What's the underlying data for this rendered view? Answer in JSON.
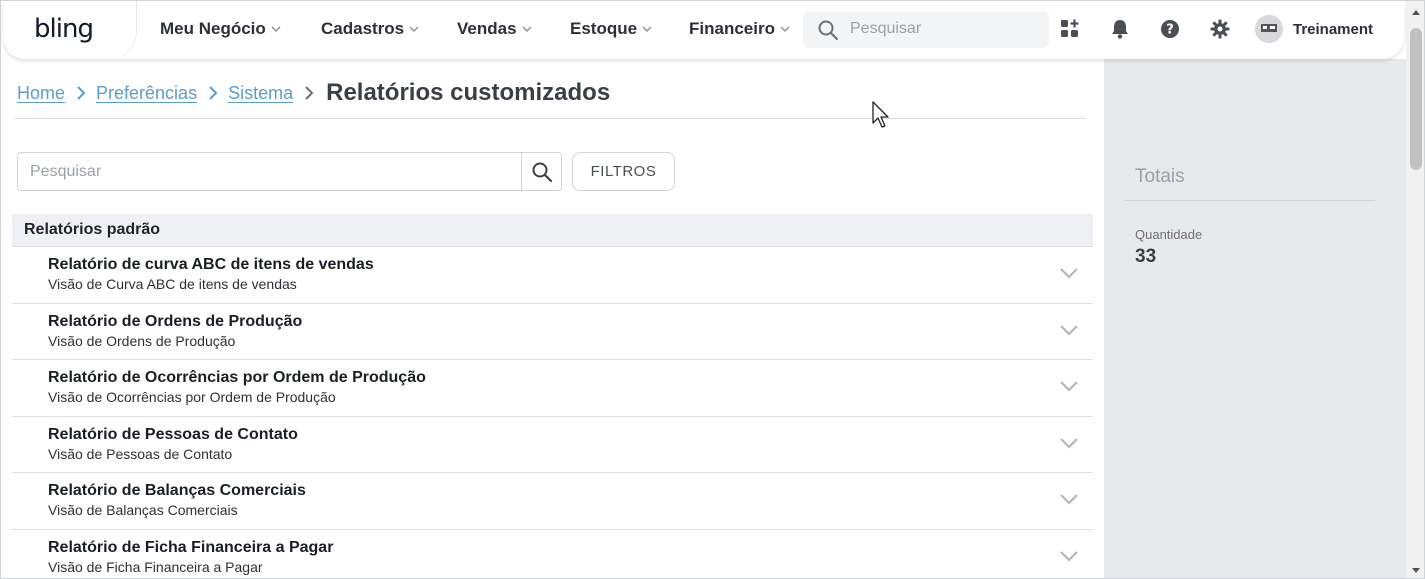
{
  "header": {
    "logo": "bling",
    "nav": [
      {
        "label": "Meu Negócio"
      },
      {
        "label": "Cadastros"
      },
      {
        "label": "Vendas"
      },
      {
        "label": "Estoque"
      },
      {
        "label": "Financeiro"
      }
    ],
    "search_placeholder": "Pesquisar",
    "user_name": "Treinament",
    "icons": [
      "apps-icon",
      "bell-icon",
      "help-icon",
      "gear-icon"
    ]
  },
  "breadcrumb": {
    "items": [
      "Home",
      "Preferências",
      "Sistema"
    ],
    "current": "Relatórios customizados"
  },
  "list": {
    "search_placeholder": "Pesquisar",
    "filter_label": "FILTROS",
    "section_title": "Relatórios padrão",
    "items": [
      {
        "title": "Relatório de curva ABC de itens de vendas",
        "subtitle": "Visão de Curva ABC de itens de vendas"
      },
      {
        "title": "Relatório de Ordens de Produção",
        "subtitle": "Visão de Ordens de Produção"
      },
      {
        "title": "Relatório de Ocorrências por Ordem de Produção",
        "subtitle": "Visão de Ocorrências por Ordem de Produção"
      },
      {
        "title": "Relatório de Pessoas de Contato",
        "subtitle": "Visão de Pessoas de Contato"
      },
      {
        "title": "Relatório de Balanças Comerciais",
        "subtitle": "Visão de Balanças Comerciais"
      },
      {
        "title": "Relatório de Ficha Financeira a Pagar",
        "subtitle": "Visão de Ficha Financeira a Pagar"
      }
    ]
  },
  "totals": {
    "title": "Totais",
    "quantity_label": "Quantidade",
    "quantity_value": "33"
  },
  "colors": {
    "link": "#5a9ec9",
    "side_panel": "#e8e9eb",
    "section_header": "#eef0f3"
  }
}
